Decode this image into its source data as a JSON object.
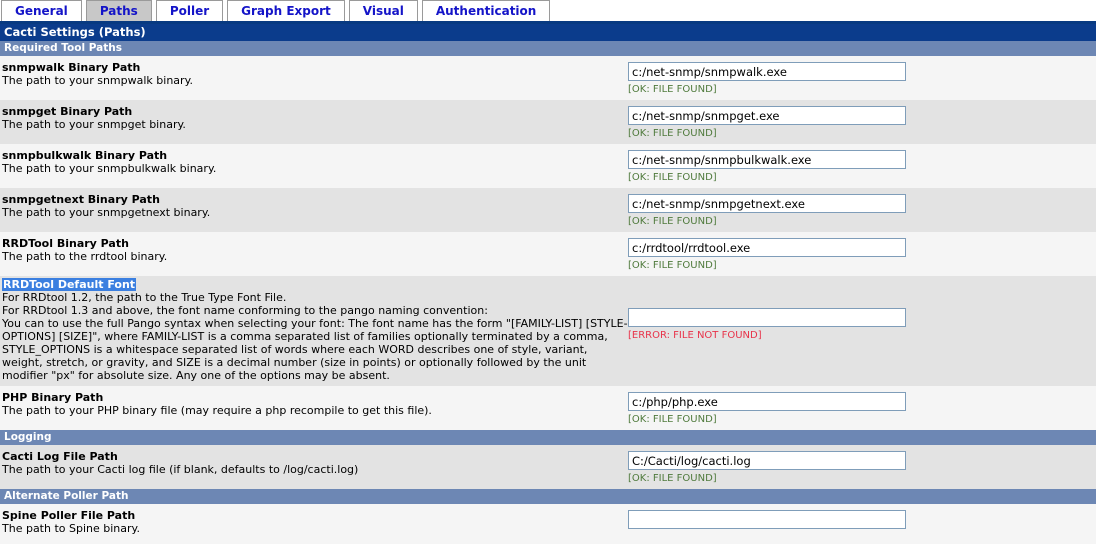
{
  "tabs": [
    {
      "label": "General",
      "selected": false
    },
    {
      "label": "Paths",
      "selected": true
    },
    {
      "label": "Poller",
      "selected": false
    },
    {
      "label": "Graph Export",
      "selected": false
    },
    {
      "label": "Visual",
      "selected": false
    },
    {
      "label": "Authentication",
      "selected": false
    }
  ],
  "page": {
    "title": "Cacti Settings (Paths)"
  },
  "colors": {
    "title_bar": "#0b3c8c",
    "section_header": "#6d87b4",
    "tab_text": "#1414c8",
    "status_ok": "#4f7a3c",
    "status_error": "#e8334a",
    "selection_highlight": "#3b7fe0"
  },
  "sections": [
    {
      "header": "Required Tool Paths",
      "fields": [
        {
          "label": "snmpwalk Binary Path",
          "desc": [
            "The path to your snmpwalk binary."
          ],
          "value": "c:/net-snmp/snmpwalk.exe",
          "status": "[OK: FILE FOUND]",
          "status_type": "ok",
          "highlighted": false
        },
        {
          "label": "snmpget Binary Path",
          "desc": [
            "The path to your snmpget binary."
          ],
          "value": "c:/net-snmp/snmpget.exe",
          "status": "[OK: FILE FOUND]",
          "status_type": "ok",
          "highlighted": false
        },
        {
          "label": "snmpbulkwalk Binary Path",
          "desc": [
            "The path to your snmpbulkwalk binary."
          ],
          "value": "c:/net-snmp/snmpbulkwalk.exe",
          "status": "[OK: FILE FOUND]",
          "status_type": "ok",
          "highlighted": false
        },
        {
          "label": "snmpgetnext Binary Path",
          "desc": [
            "The path to your snmpgetnext binary."
          ],
          "value": "c:/net-snmp/snmpgetnext.exe",
          "status": "[OK: FILE FOUND]",
          "status_type": "ok",
          "highlighted": false
        },
        {
          "label": "RRDTool Binary Path",
          "desc": [
            "The path to the rrdtool binary."
          ],
          "value": "c:/rrdtool/rrdtool.exe",
          "status": "[OK: FILE FOUND]",
          "status_type": "ok",
          "highlighted": false
        },
        {
          "label": "RRDTool Default Font",
          "desc": [
            "For RRDtool 1.2, the path to the True Type Font File.",
            "For RRDtool 1.3 and above, the font name conforming to the pango naming convention:",
            "You can to use the full Pango syntax when selecting your font: The font name has the form \"[FAMILY-LIST] [STYLE-OPTIONS] [SIZE]\", where FAMILY-LIST is a comma separated list of families optionally terminated by a comma, STYLE_OPTIONS is a whitespace separated list of words where each WORD describes one of style, variant, weight, stretch, or gravity, and SIZE is a decimal number (size in points) or optionally followed by the unit modifier \"px\" for absolute size. Any one of the options may be absent."
          ],
          "value": "",
          "status": "[ERROR: FILE NOT FOUND]",
          "status_type": "err",
          "highlighted": true,
          "tall": true
        },
        {
          "label": "PHP Binary Path",
          "desc": [
            "The path to your PHP binary file (may require a php recompile to get this file)."
          ],
          "value": "c:/php/php.exe",
          "status": "[OK: FILE FOUND]",
          "status_type": "ok",
          "highlighted": false
        }
      ]
    },
    {
      "header": "Logging",
      "fields": [
        {
          "label": "Cacti Log File Path",
          "desc": [
            "The path to your Cacti log file (if blank, defaults to /log/cacti.log)"
          ],
          "value": "C:/Cacti/log/cacti.log",
          "status": "[OK: FILE FOUND]",
          "status_type": "ok",
          "highlighted": false
        }
      ]
    },
    {
      "header": "Alternate Poller Path",
      "fields": [
        {
          "label": "Spine Poller File Path",
          "desc": [
            "The path to Spine binary."
          ],
          "value": "",
          "status": "",
          "status_type": "none",
          "highlighted": false
        }
      ]
    }
  ]
}
